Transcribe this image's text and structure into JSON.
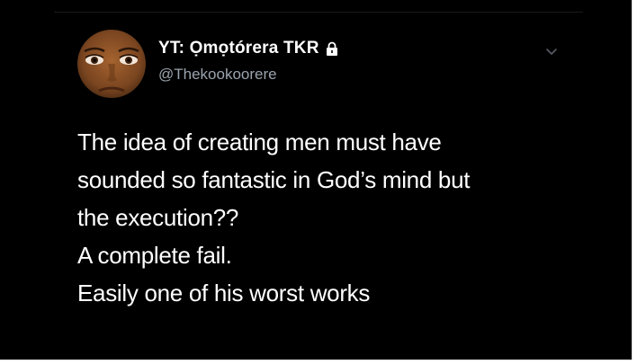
{
  "tweet": {
    "display_name": "YT: Ọmọtórera TKR",
    "handle": "@Thekookoorere",
    "protected_icon": "lock-icon",
    "menu_icon": "chevron-down-icon",
    "lines": [
      "The idea of creating men must have",
      "sounded so fantastic in God’s mind but",
      "the execution??",
      "A complete fail.",
      "Easily one of his worst works"
    ]
  },
  "colors": {
    "background": "#000000",
    "text": "#ffffff",
    "handle": "#9aa3ad"
  }
}
